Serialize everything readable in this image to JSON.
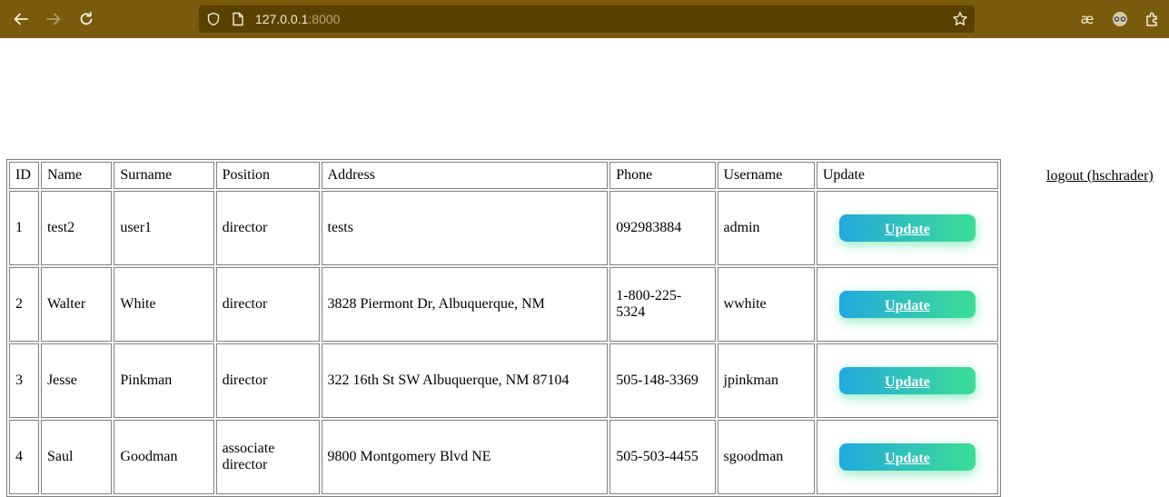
{
  "browser": {
    "url_host": "127.0.0.1",
    "url_port": ":8000",
    "icons": [
      "back-arrow-icon",
      "forward-arrow-icon",
      "reload-icon",
      "shield-icon",
      "page-icon",
      "bookmark-star-icon",
      "ae-extension-icon",
      "glasses-extension-icon",
      "extensions-puzzle-icon"
    ]
  },
  "table": {
    "headers": [
      "ID",
      "Name",
      "Surname",
      "Position",
      "Address",
      "Phone",
      "Username",
      "Update"
    ],
    "rows": [
      {
        "id": "1",
        "name": "test2",
        "surname": "user1",
        "position": "director",
        "address": "tests",
        "phone": "092983884",
        "username": "admin",
        "update_label": "Update"
      },
      {
        "id": "2",
        "name": "Walter",
        "surname": "White",
        "position": "director",
        "address": "3828 Piermont Dr, Albuquerque, NM",
        "phone": "1-800-225-5324",
        "username": "wwhite",
        "update_label": "Update"
      },
      {
        "id": "3",
        "name": "Jesse",
        "surname": "Pinkman",
        "position": "director",
        "address": "322 16th St SW Albuquerque, NM 87104",
        "phone": "505-148-3369",
        "username": "jpinkman",
        "update_label": "Update"
      },
      {
        "id": "4",
        "name": "Saul",
        "surname": "Goodman",
        "position": "associate director",
        "address": "9800 Montgomery Blvd NE",
        "phone": "505-503-4455",
        "username": "sgoodman",
        "update_label": "Update"
      }
    ]
  },
  "logout_label": "logout (hschrader)",
  "colors": {
    "toolbar": "#7a5a0c",
    "urlbar": "#5b4100",
    "button_gradient_start": "#22a9dd",
    "button_gradient_end": "#3ddd95"
  }
}
